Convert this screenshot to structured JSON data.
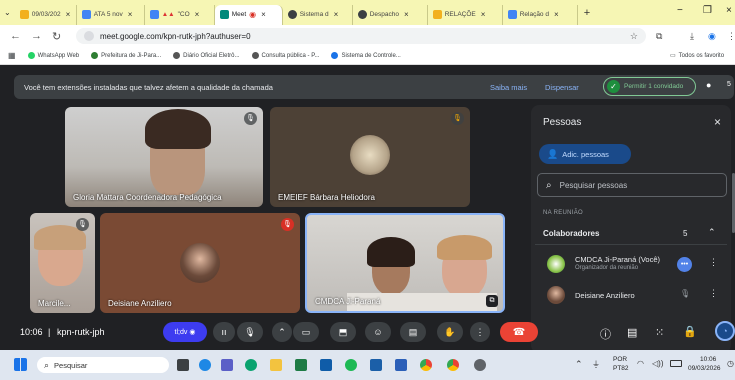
{
  "tabs": [
    {
      "label": "09/03/202",
      "color": "#f2b01e"
    },
    {
      "label": "ATA 5 nov",
      "color": "#4285f4"
    },
    {
      "label": "\"CO",
      "color": "#4285f4"
    },
    {
      "label": "Meet",
      "color": "#00897b"
    },
    {
      "label": "Sistema d",
      "color": "#3c4043"
    },
    {
      "label": "Despacho",
      "color": "#3c4043"
    },
    {
      "label": "RELAÇÕE",
      "color": "#f2b01e"
    },
    {
      "label": "Relação d",
      "color": "#4285f4"
    }
  ],
  "address": {
    "url": "meet.google.com/kpn-rutk-jph?authuser=0"
  },
  "bookmarks": [
    "WhatsApp Web",
    "Prefeitura de Ji-Para...",
    "Diário Oficial Eletrô...",
    "Consulta pública - P...",
    "Sistema de Controle..."
  ],
  "bookmarks_all": "Todos os favorito",
  "warning": {
    "text": "Você tem extensões instaladas que talvez afetem a qualidade da chamada",
    "learn": "Saiba mais",
    "dismiss": "Dispensar",
    "allow": "Permitir 1 convidado",
    "count": "5"
  },
  "tiles": {
    "t1": "Gloria Mattara Coordenadora Pedagógica",
    "t2": "EMEIEF Bárbara Heliodora",
    "t3": "Marcile...",
    "t4": "Deisiane Anziliero",
    "t5": "CMDCA Ji-Paraná"
  },
  "panel": {
    "title": "Pessoas",
    "add": "Adic. pessoas",
    "search_placeholder": "Pesquisar pessoas",
    "section": "NA REUNIÃO",
    "group": "Colaboradores",
    "group_count": "5",
    "p1_name": "CMDCA Ji-Paraná (Você)",
    "p1_role": "Organizador da reunião",
    "p2_name": "Deisiane Anziliero"
  },
  "bottom": {
    "time": "10:06",
    "code": "kpn-rutk-jph"
  },
  "taskbar": {
    "search": "Pesquisar",
    "lang": "POR",
    "layout": "PT82",
    "clock": "10:06",
    "date": "09/03/2026"
  }
}
